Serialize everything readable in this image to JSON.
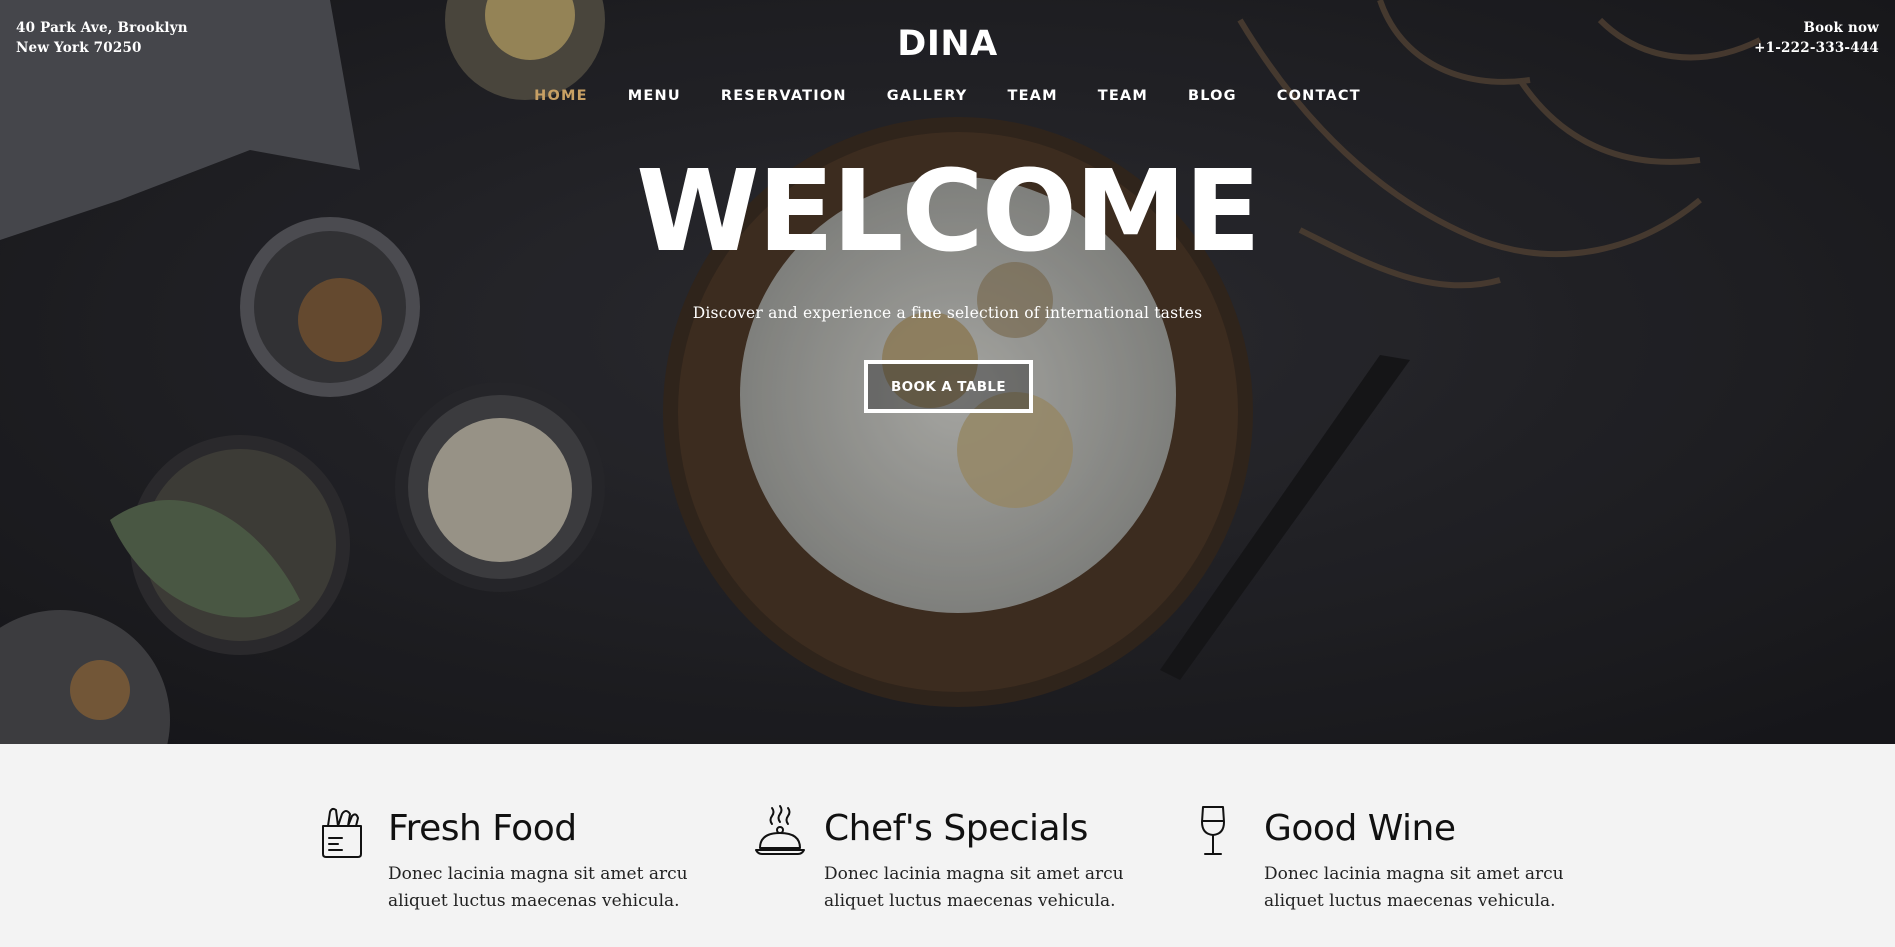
{
  "header": {
    "address_line1": "40 Park Ave, Brooklyn",
    "address_line2": "New York 70250",
    "book_label": "Book now",
    "phone": "+1-222-333-444",
    "logo": "DINA"
  },
  "nav": {
    "items": [
      {
        "label": "HOME",
        "active": true
      },
      {
        "label": "MENU"
      },
      {
        "label": "RESERVATION"
      },
      {
        "label": "GALLERY"
      },
      {
        "label": "TEAM"
      },
      {
        "label": "TEAM"
      },
      {
        "label": "BLOG"
      },
      {
        "label": "CONTACT"
      }
    ],
    "active_color": "#c8a064"
  },
  "hero": {
    "title": "WELCOME",
    "subtitle": "Discover and experience a fine selection of international tastes",
    "cta_label": "BOOK A TABLE"
  },
  "features": [
    {
      "icon": "grocery-bag-icon",
      "title": "Fresh Food",
      "text": "Donec lacinia magna sit amet arcu aliquet luctus maecenas vehicula."
    },
    {
      "icon": "cloche-icon",
      "title": "Chef's Specials",
      "text": "Donec lacinia magna sit amet arcu aliquet luctus maecenas vehicula."
    },
    {
      "icon": "wine-glass-icon",
      "title": "Good Wine",
      "text": "Donec lacinia magna sit amet arcu aliquet luctus maecenas vehicula."
    }
  ]
}
